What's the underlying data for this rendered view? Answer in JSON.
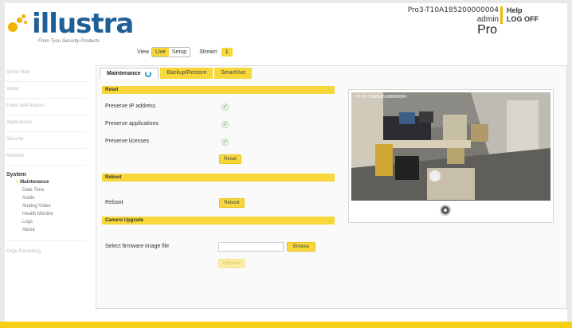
{
  "header": {
    "logo_text": "illustra",
    "logo_subtitle": "From Tyco Security Products",
    "view_label": "View",
    "live_label": "Live",
    "setup_label": "Setup",
    "stream_label": "Stream",
    "stream_value": "1",
    "device_name": "Pro3-T10A185200000004",
    "user": "admin",
    "help_label": "Help",
    "logoff_label": "LOG OFF",
    "model": "Pro"
  },
  "sidebar": {
    "items": [
      "Quick Start",
      "Video",
      "Event and Actions",
      "Applications",
      "Security",
      "Network"
    ],
    "system_label": "System",
    "sub_items": [
      "Maintenance",
      "Date Time",
      "Audio",
      "Analog Video",
      "Health Monitor",
      "Logs",
      "About"
    ],
    "edge_recording": "Edge Recording"
  },
  "tabs": [
    "Maintenance",
    "Backup/Restore",
    "SmartVue"
  ],
  "reset": {
    "title": "Reset",
    "preserve_ip": "Preserve IP address",
    "preserve_apps": "Preserve applications",
    "preserve_licenses": "Preserve licenses",
    "reset_button": "Reset"
  },
  "reboot": {
    "title": "Reboot",
    "label": "Reboot",
    "button": "Reboot"
  },
  "upgrade": {
    "title": "Camera Upgrade",
    "select_label": "Select firmware image file",
    "browse_button": "Browse",
    "upgrade_button": "Upgrade"
  },
  "video": {
    "overlay": "Pro3-T10A185200000004"
  },
  "colors": {
    "accent_yellow": "#f7d73a",
    "brand_blue": "#1f5f97",
    "check_green": "#4aa24a"
  }
}
